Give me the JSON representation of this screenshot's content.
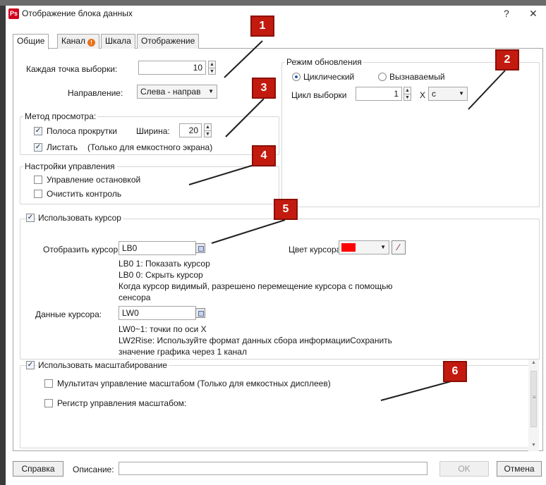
{
  "window": {
    "title": "Отображение блока данных",
    "icon_text": "Ps",
    "help_glyph": "?",
    "close_glyph": "✕"
  },
  "tabs": [
    {
      "label": "Общие"
    },
    {
      "label": "Канал"
    },
    {
      "label": "Шкала"
    },
    {
      "label": "Отображение"
    }
  ],
  "general": {
    "sample_points_label": "Каждая точка выборки:",
    "sample_points_value": "10",
    "direction_label": "Направление:",
    "direction_value": "Слева - направ"
  },
  "view_method": {
    "title": "Метод просмотра:",
    "scrollbar_label": "Полоса прокрутки",
    "width_label": "Ширина:",
    "width_value": "20",
    "flip_label": "Листать",
    "flip_note": "(Только для емкостного экрана)"
  },
  "control": {
    "title": "Настройки управления",
    "stop_label": "Управление остановкой",
    "clear_label": "Очистить контроль"
  },
  "refresh": {
    "title": "Режим обновления",
    "cyclic_label": "Циклический",
    "called_label": "Вызнаваемый",
    "cycle_label": "Цикл выборки",
    "cycle_value": "1",
    "x_label": "X",
    "unit_value": "с"
  },
  "cursor": {
    "use_label": "Использовать курсор",
    "show_label": "Отобразить курсор:",
    "show_value": "LB0",
    "color_label": "Цвет курсора",
    "color_value": "#ff0000",
    "hint1": "LB0  1: Показать курсор",
    "hint2": "LB0  0: Скрыть курсор",
    "hint3": "Когда курсор видимый, разрешено перемещение курсора с помощью",
    "hint4": "сенсора",
    "data_label": "Данные курсора:",
    "data_value": "LW0",
    "data_hint1": "LW0~1: точки по оси X",
    "data_hint2": "LW2Rise: Используйте формат данных сбора информацииСохранить",
    "data_hint3": "значение графика через 1 канал"
  },
  "scaling": {
    "use_label": "Использовать масштабирование",
    "multitouch_label": "Мультитач управление масштабом (Только для емкостных дисплеев)",
    "register_label": "Регистр управления масштабом:"
  },
  "footer": {
    "help_button": "Справка",
    "description_label": "Описание:",
    "description_value": "",
    "ok_button": "OK",
    "cancel_button": "Отмена"
  },
  "callouts": [
    "1",
    "2",
    "3",
    "4",
    "5",
    "6"
  ],
  "colors": {
    "callout_red": "#c31a0f",
    "callout_line": "#1f1f1f",
    "cursor_color": "#ff0000"
  }
}
